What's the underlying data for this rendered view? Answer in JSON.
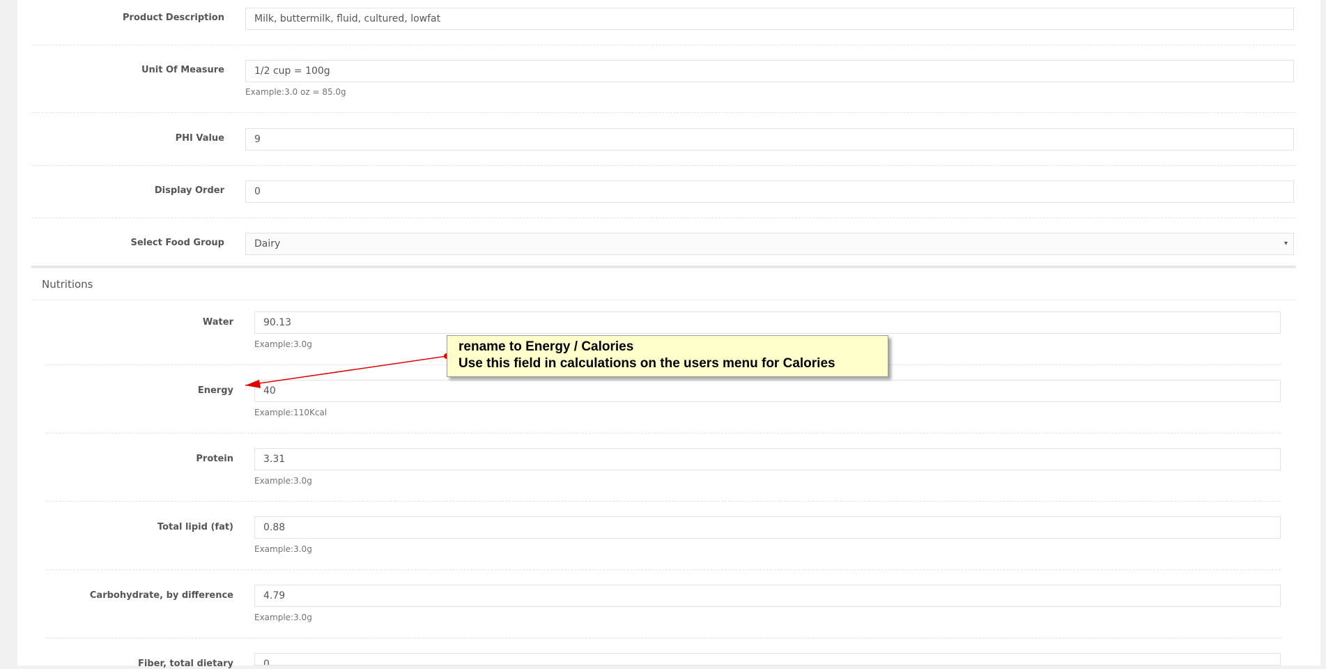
{
  "form": {
    "product_description": {
      "label": "Product Description",
      "value": "Milk, buttermilk, fluid, cultured, lowfat"
    },
    "unit_of_measure": {
      "label": "Unit Of Measure",
      "value": "1/2 cup = 100g",
      "help": "Example:3.0 oz = 85.0g"
    },
    "phi_value": {
      "label": "PHI Value",
      "value": "9"
    },
    "display_order": {
      "label": "Display Order",
      "value": "0"
    },
    "food_group": {
      "label": "Select Food Group",
      "value": "Dairy"
    }
  },
  "nutritions": {
    "title": "Nutritions",
    "fields": [
      {
        "label": "Water",
        "value": "90.13",
        "help": "Example:3.0g"
      },
      {
        "label": "Energy",
        "value": "40",
        "help": "Example:110Kcal"
      },
      {
        "label": "Protein",
        "value": "3.31",
        "help": "Example:3.0g"
      },
      {
        "label": "Total lipid (fat)",
        "value": "0.88",
        "help": "Example:3.0g"
      },
      {
        "label": "Carbohydrate, by difference",
        "value": "4.79",
        "help": "Example:3.0g"
      },
      {
        "label": "Fiber, total dietary",
        "value": "0",
        "help": ""
      }
    ]
  },
  "annotation": {
    "line1": "rename to Energy / Calories",
    "line2": "Use this field in calculations on the users menu for Calories",
    "arrow_color": "#e00000"
  },
  "icons": {
    "caret": "▾"
  }
}
